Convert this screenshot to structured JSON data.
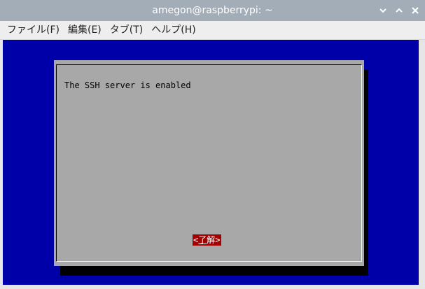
{
  "window": {
    "title": "amegon@raspberrypi: ~",
    "controls": [
      "chevron-down-icon",
      "chevron-up-icon",
      "close-icon"
    ]
  },
  "menubar": {
    "items": [
      {
        "label": "ファイル(F)"
      },
      {
        "label": "編集(E)"
      },
      {
        "label": "タブ(T)"
      },
      {
        "label": "ヘルプ(H)"
      }
    ]
  },
  "terminal": {
    "colors": {
      "background": "#0000a8",
      "dialog": "#a8a8a8",
      "button": "#a40000"
    },
    "dialog": {
      "message": "The SSH server is enabled",
      "ok_button": {
        "left": "<",
        "label_first": "了",
        "label_rest": "解",
        "right": ">"
      }
    }
  }
}
